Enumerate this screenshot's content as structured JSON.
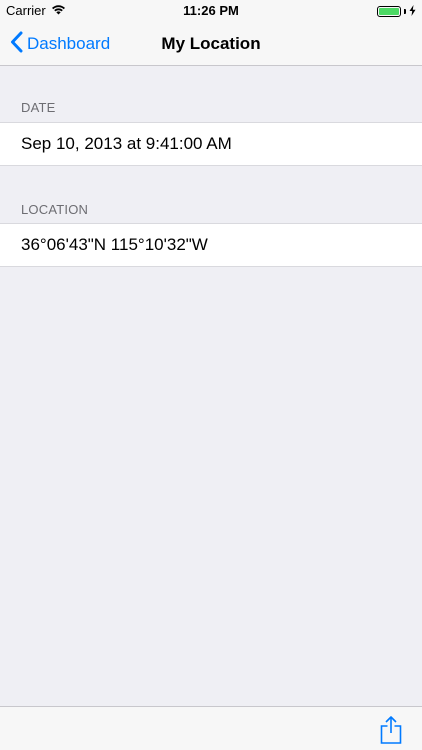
{
  "status_bar": {
    "carrier": "Carrier",
    "time": "11:26 PM",
    "battery_color": "#4cd964"
  },
  "nav": {
    "back_label": "Dashboard",
    "title": "My Location",
    "accent_color": "#007aff"
  },
  "sections": [
    {
      "header": "DATE",
      "value": "Sep 10, 2013 at 9:41:00 AM"
    },
    {
      "header": "LOCATION",
      "value": "36°06'43\"N 115°10'32\"W"
    }
  ],
  "toolbar": {
    "share_icon": "share-icon"
  }
}
